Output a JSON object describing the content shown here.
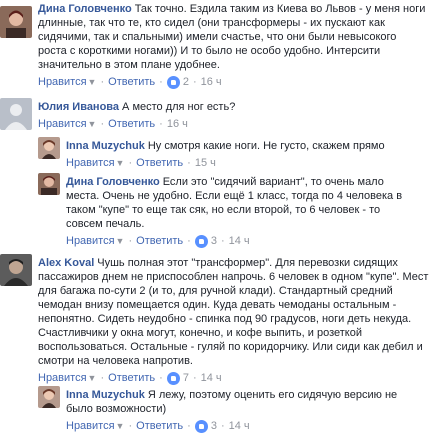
{
  "comments": [
    {
      "author": "Дина Головченко",
      "text": "Так точно. Ездила таким из Киева во Львов - у меня ноги длинные, так что те, кто сидел (они трансформеры - их пускают как сидячими, так и спальными) имели счастье, что они были невысокого роста с короткими ногами)) И то было не особо удобно. Интерсити значительно в этом плане удобнее.",
      "like": "Нравится",
      "reply": "Ответить",
      "reactions": "2",
      "time": "16 ч"
    },
    {
      "author": "Юлия Иванова",
      "text": "А место для ног есть?",
      "like": "Нравится",
      "reply": "Ответить",
      "reactions": "",
      "time": "16 ч"
    },
    {
      "author": "Inna Muzychuk",
      "text": "Ну смотря какие ноги. Не густо, скажем прямо",
      "like": "Нравится",
      "reply": "Ответить",
      "reactions": "",
      "time": "15 ч"
    },
    {
      "author": "Дина Головченко",
      "text": "Если это \"сидячий вариант\", то очень мало места. Очень не удобно. Если ещё 1 класс, тогда по 4 человека в таком \"купе\" то еще так сяк, но если второй, то 6 человек - то совсем печаль.",
      "like": "Нравится",
      "reply": "Ответить",
      "reactions": "3",
      "time": "14 ч"
    },
    {
      "author": "Alex Koval",
      "text": "Чушь полная этот \"трансформер\". Для перевозки сидящих пассажиров днем не приспособлен напрочь. 6 человек в одном \"купе\". Мест для багажа по-сути 2 (и то, для ручной клади). Стандартный средний чемодан внизу помещается один. Куда девать чемоданы остальным - непонятно. Сидеть неудобно - спинка под 90 градусов, ноги деть некуда. Счастливчики у окна могут, конечно, и кофе выпить, и розеткой воспользоваться. Остальные - гуляй по коридорчику. Или сиди как дебил и смотри на человека напротив.",
      "like": "Нравится",
      "reply": "Ответить",
      "reactions": "7",
      "time": "14 ч"
    },
    {
      "author": "Inna Muzychuk",
      "text": "Я лежу, поэтому оценить его сидячую версию не было возможности)",
      "like": "Нравится",
      "reply": "Ответить",
      "reactions": "3",
      "time": "14 ч"
    }
  ],
  "colors": {
    "author": "#365899",
    "action": "#4267b2",
    "meta": "#90949c",
    "like_icon": "#5890ff"
  }
}
